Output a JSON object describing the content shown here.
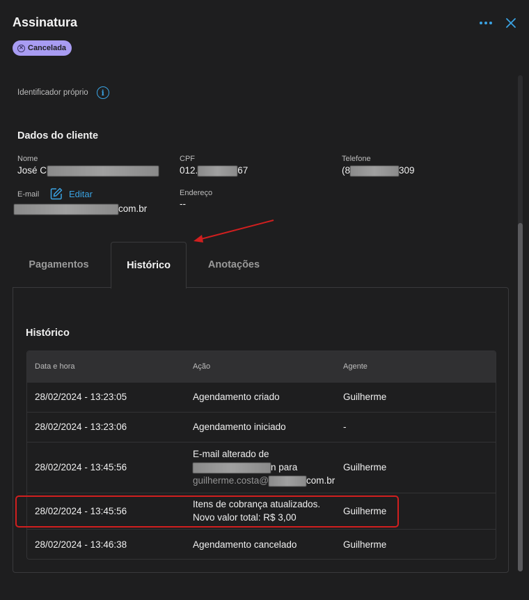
{
  "header": {
    "title": "Assinatura",
    "status": "Cancelada"
  },
  "own_id": {
    "label": "Identificador próprio"
  },
  "client": {
    "section_title": "Dados do cliente",
    "name": {
      "label": "Nome",
      "visible_prefix": "José C"
    },
    "cpf": {
      "label": "CPF",
      "prefix": "012.",
      "suffix": "67"
    },
    "phone": {
      "label": "Telefone",
      "prefix": "(8",
      "suffix": "309"
    },
    "email": {
      "label": "E-mail",
      "edit_label": "Editar",
      "suffix": "com.br"
    },
    "address": {
      "label": "Endereço",
      "value": "--"
    }
  },
  "tabs": [
    {
      "label": "Pagamentos",
      "active": false
    },
    {
      "label": "Histórico",
      "active": true
    },
    {
      "label": "Anotações",
      "active": false
    }
  ],
  "history": {
    "title": "Histórico",
    "columns": [
      "Data e hora",
      "Ação",
      "Agente"
    ],
    "rows": [
      {
        "datetime": "28/02/2024 - 13:23:05",
        "action": "Agendamento criado",
        "agent": "Guilherme"
      },
      {
        "datetime": "28/02/2024 - 13:23:06",
        "action": "Agendamento iniciado",
        "agent": "-"
      },
      {
        "datetime": "28/02/2024 - 13:45:56",
        "action_line1": "E-mail alterado de",
        "action_line2_suffix": "n para",
        "action_line3_prefix": "guilherme.costa@",
        "action_line3_suffix": "com.br",
        "agent": "Guilherme"
      },
      {
        "datetime": "28/02/2024 - 13:45:56",
        "action_line1": "Itens de cobrança atualizados.",
        "action_line2": "Novo valor total: R$ 3,00",
        "agent": "Guilherme"
      },
      {
        "datetime": "28/02/2024 - 13:46:38",
        "action": "Agendamento cancelado",
        "agent": "Guilherme"
      }
    ]
  },
  "colors": {
    "accent": "#3aa3e3",
    "badge": "#a89cf2",
    "annotation": "#d11f1f",
    "background": "#1e1e1f"
  }
}
